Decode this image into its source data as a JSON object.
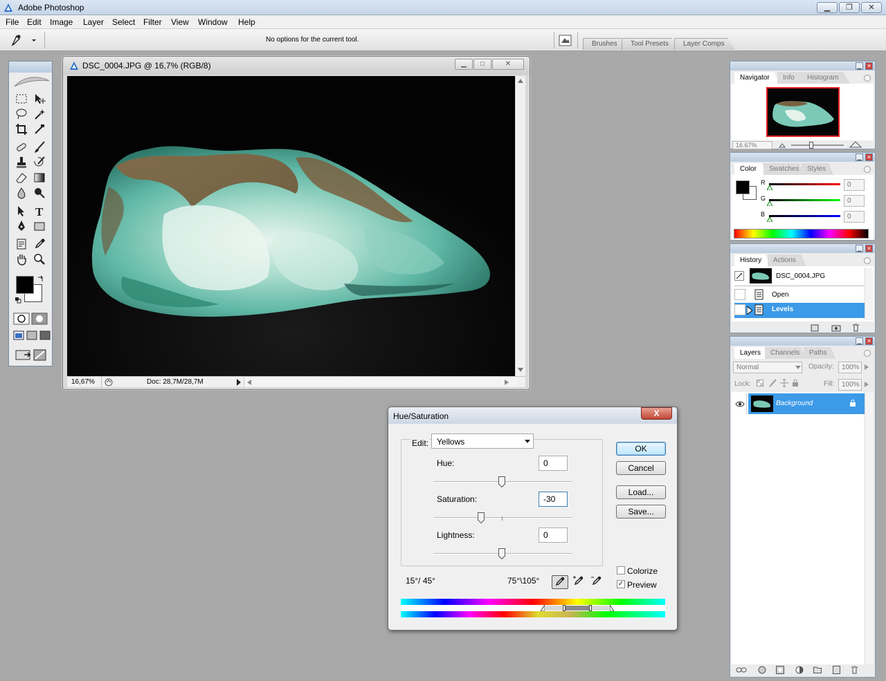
{
  "app": {
    "title": "Adobe Photoshop",
    "menu": [
      "File",
      "Edit",
      "Image",
      "Layer",
      "Select",
      "Filter",
      "View",
      "Window",
      "Help"
    ]
  },
  "options_bar": {
    "message": "No options for the current tool.",
    "well_tabs": [
      "Brushes",
      "Tool Presets",
      "Layer Comps"
    ]
  },
  "document": {
    "title": "DSC_0004.JPG @ 16,7% (RGB/8)",
    "zoom": "16,67%",
    "doc_info": "Doc: 28,7M/28,7M"
  },
  "navigator": {
    "tabs": [
      "Navigator",
      "Info",
      "Histogram"
    ],
    "zoom": "16.67%"
  },
  "color": {
    "tabs": [
      "Color",
      "Swatches",
      "Styles"
    ],
    "channels": [
      {
        "label": "R",
        "value": "0",
        "color": "#e01010"
      },
      {
        "label": "G",
        "value": "0",
        "color": "#10b010"
      },
      {
        "label": "B",
        "value": "0",
        "color": "#1010d0"
      }
    ]
  },
  "history": {
    "tabs": [
      "History",
      "Actions"
    ],
    "snapshot": "DSC_0004.JPG",
    "steps": [
      "Open",
      "Levels"
    ],
    "selected": 1
  },
  "layers": {
    "tabs": [
      "Layers",
      "Channels",
      "Paths"
    ],
    "blend_mode": "Normal",
    "opacity_label": "Opacity:",
    "opacity": "100%",
    "lock_label": "Lock:",
    "fill_label": "Fill:",
    "fill": "100%",
    "layer_name": "Background"
  },
  "dialog": {
    "title": "Hue/Saturation",
    "close": "X",
    "edit_label": "Edit:",
    "edit_value": "Yellows",
    "hue_label": "Hue:",
    "hue_value": "0",
    "saturation_label": "Saturation:",
    "saturation_value": "-30",
    "lightness_label": "Lightness:",
    "lightness_value": "0",
    "range_left": "15°/ 45°",
    "range_right": "75°\\105°",
    "buttons": {
      "ok": "OK",
      "cancel": "Cancel",
      "load": "Load...",
      "save": "Save..."
    },
    "colorize_label": "Colorize",
    "colorize_checked": false,
    "preview_label": "Preview",
    "preview_checked": true
  },
  "colors": {
    "selection": "#3c9ae8",
    "close_red": "#c24634"
  }
}
